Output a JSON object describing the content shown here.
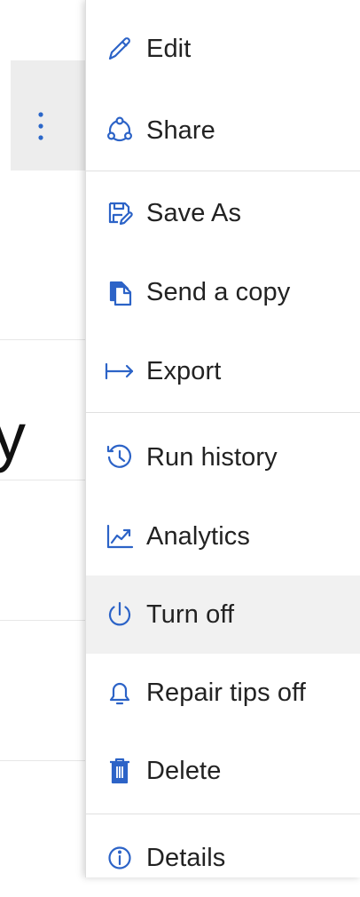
{
  "left_panel": {
    "more_icon": "vertical-ellipsis-icon",
    "edge_fragment": "y"
  },
  "menu": {
    "items": [
      {
        "label": "Edit",
        "icon": "pencil-icon"
      },
      {
        "label": "Share",
        "icon": "share-icon"
      },
      {
        "label": "Save As",
        "icon": "save-as-icon"
      },
      {
        "label": "Send a copy",
        "icon": "send-copy-icon"
      },
      {
        "label": "Export",
        "icon": "export-arrow-icon"
      },
      {
        "label": "Run history",
        "icon": "history-icon"
      },
      {
        "label": "Analytics",
        "icon": "analytics-icon"
      },
      {
        "label": "Turn off",
        "icon": "power-icon",
        "highlighted": true
      },
      {
        "label": "Repair tips off",
        "icon": "bell-icon"
      },
      {
        "label": "Delete",
        "icon": "trash-icon"
      },
      {
        "label": "Details",
        "icon": "info-icon"
      }
    ]
  },
  "colors": {
    "accent": "#2c63c7",
    "hover": "#f1f1f1",
    "text": "#222222"
  }
}
